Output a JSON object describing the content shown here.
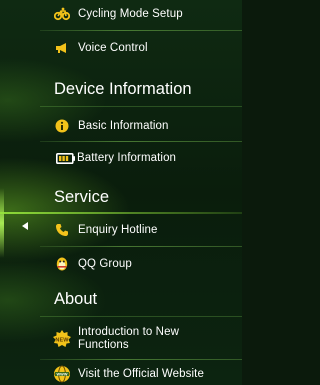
{
  "menu": {
    "cycling_mode_setup": "Cycling Mode Setup",
    "voice_control": "Voice Control",
    "device_information": "Device Information",
    "basic_information": "Basic Information",
    "battery_information": "Battery Information",
    "service": "Service",
    "enquiry_hotline": "Enquiry Hotline",
    "qq_group": "QQ Group",
    "about": "About",
    "introduction_new_functions": "Introduction to New\nFunctions",
    "visit_official_website": "Visit the Official Website"
  },
  "icons": {
    "cycling": "cycling-icon",
    "voice": "megaphone-icon",
    "basic_info": "info-icon",
    "battery": "battery-icon",
    "phone": "phone-icon",
    "qq": "qq-penguin-icon",
    "new": "new-badge-icon",
    "website": "globe-icon",
    "collapse": "arrow-left-icon"
  },
  "colors": {
    "accent": "#9bd83a",
    "text": "#ffffff",
    "info_icon": "#f2c21a",
    "phone_icon": "#f4c31c"
  }
}
